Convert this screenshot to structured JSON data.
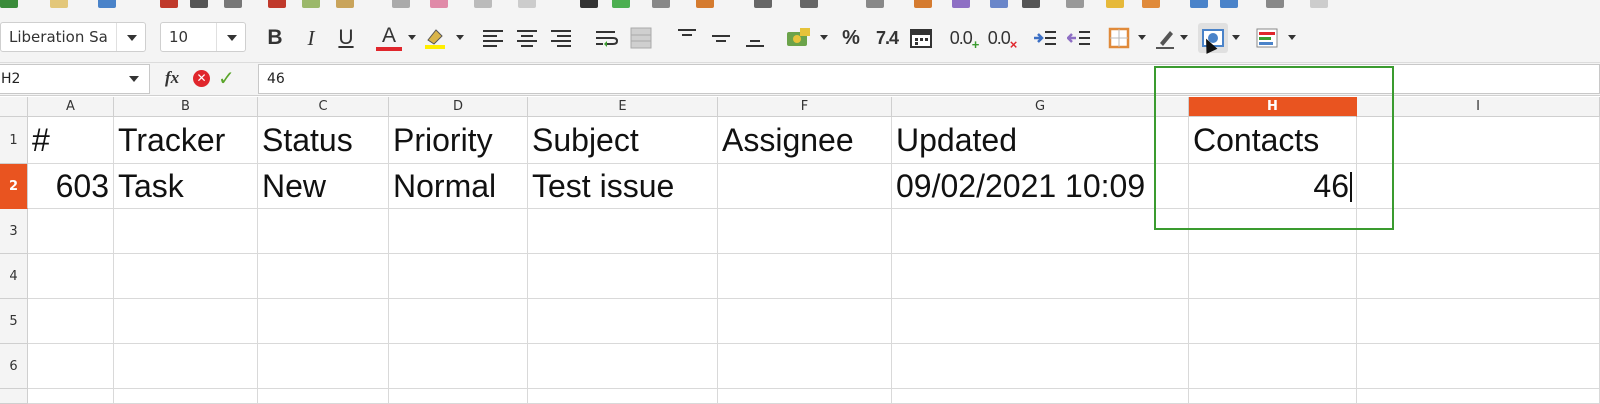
{
  "toolbar": {
    "font_name": "Liberation Sa",
    "font_size": "10",
    "bold_label": "B",
    "italic_label": "I",
    "underline_label": "U",
    "font_color_label": "A",
    "percent_label": "%",
    "number_format_label": "7.4",
    "add_decimal_label": "0.0",
    "delete_decimal_label": "0.0",
    "icons": [
      "font-color-icon",
      "highlight-icon",
      "align-left-icon",
      "align-center-icon",
      "align-right-icon",
      "wrap-text-icon",
      "merge-cells-icon",
      "align-top-icon",
      "align-middle-icon",
      "align-bottom-icon",
      "currency-icon",
      "date-icon",
      "increase-indent-icon",
      "decrease-indent-icon",
      "borders-icon",
      "border-style-icon",
      "conditional-format-icon",
      "styles-icon"
    ]
  },
  "formula_bar": {
    "name_box": "H2",
    "fx_label": "fx",
    "content": "46"
  },
  "columns": [
    "A",
    "B",
    "C",
    "D",
    "E",
    "F",
    "G",
    "H",
    "I"
  ],
  "active_column": "H",
  "rows": [
    "1",
    "2",
    "3",
    "4",
    "5",
    "6"
  ],
  "active_row": "2",
  "cells": {
    "A1": "#",
    "B1": "Tracker",
    "C1": "Status",
    "D1": "Priority",
    "E1": "Subject",
    "F1": "Assignee",
    "G1": "Updated",
    "H1": "Contacts",
    "A2": "603",
    "B2": "Task",
    "C2": "New",
    "D2": "Normal",
    "E2": "Test issue",
    "F2": "",
    "G2": "09/02/2021 10:09",
    "H2": "46"
  },
  "colors": {
    "accent": "#e95420",
    "highlight_box": "#3a9b2f"
  }
}
